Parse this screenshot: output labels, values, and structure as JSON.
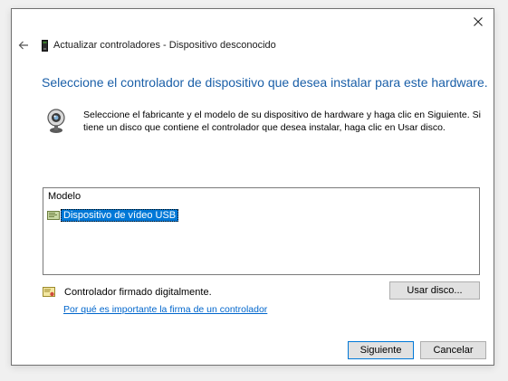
{
  "window": {
    "title": "Actualizar controladores - Dispositivo desconocido",
    "close_icon": "close-icon",
    "back_icon": "back-arrow-icon"
  },
  "heading": "Seleccione el controlador de dispositivo que desea instalar para este hardware.",
  "intro": {
    "icon": "webcam-icon",
    "text": "Seleccione el fabricante y el modelo de su dispositivo de hardware y haga clic en Siguiente. Si tiene un disco que contiene el controlador que desea instalar, haga clic en  Usar disco."
  },
  "model_list": {
    "header": "Modelo",
    "items": [
      {
        "label": "Dispositivo de vídeo USB",
        "selected": true,
        "icon": "driver-icon"
      }
    ]
  },
  "signature": {
    "icon": "certificate-icon",
    "text": "Controlador firmado digitalmente.",
    "link": "Por qué es importante la firma de un controlador"
  },
  "buttons": {
    "have_disk": "Usar disco...",
    "next": "Siguiente",
    "cancel": "Cancelar"
  },
  "colors": {
    "heading": "#1a5fa8",
    "selection": "#0078d7",
    "link": "#0066cc"
  }
}
